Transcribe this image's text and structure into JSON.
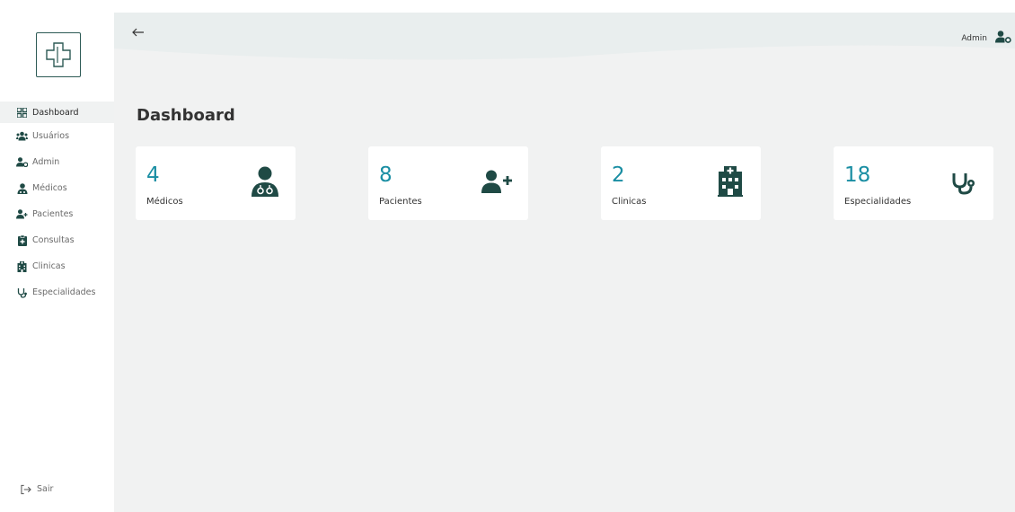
{
  "sidebar": {
    "items": [
      {
        "label": "Dashboard",
        "icon": "dashboard-icon",
        "active": true
      },
      {
        "label": "Usuários",
        "icon": "users-icon"
      },
      {
        "label": "Admin",
        "icon": "user-gear-icon"
      },
      {
        "label": "Médicos",
        "icon": "doctor-icon"
      },
      {
        "label": "Pacientes",
        "icon": "user-plus-icon"
      },
      {
        "label": "Consultas",
        "icon": "clipboard-icon"
      },
      {
        "label": "Clinicas",
        "icon": "hospital-icon"
      },
      {
        "label": "Especialidades",
        "icon": "stethoscope-icon"
      }
    ],
    "logout_label": "Sair"
  },
  "header": {
    "user_name": "Admin"
  },
  "main": {
    "title": "Dashboard",
    "cards": [
      {
        "value": "4",
        "label": "Médicos",
        "icon": "doctor-icon"
      },
      {
        "value": "8",
        "label": "Pacientes",
        "icon": "user-plus-icon"
      },
      {
        "value": "2",
        "label": "Clinicas",
        "icon": "hospital-icon"
      },
      {
        "value": "18",
        "label": "Especialidades",
        "icon": "stethoscope-icon"
      }
    ]
  },
  "colors": {
    "accent": "#1a8ea3",
    "icon_dark": "#1f4a45",
    "background": "#f1f2f2"
  }
}
